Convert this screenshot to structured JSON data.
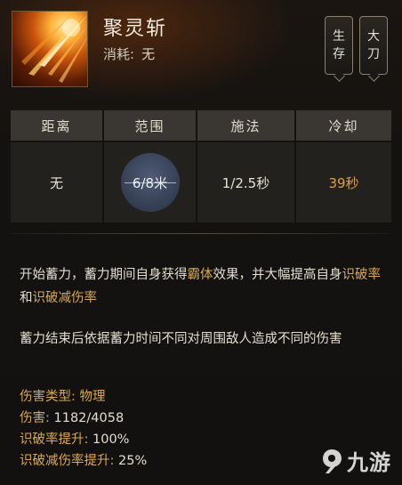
{
  "skill": {
    "name": "聚灵斩",
    "cost_label": "消耗:",
    "cost_value": "无",
    "icon": "flame-slash-icon"
  },
  "tags": [
    {
      "line1": "生",
      "line2": "存"
    },
    {
      "line1": "大",
      "line2": "刀"
    }
  ],
  "stats": {
    "headers": [
      "距离",
      "范围",
      "施法",
      "冷却"
    ],
    "values": [
      "无",
      "6/8米",
      "1/2.5秒",
      "39秒"
    ],
    "cooldown_color": "#d7a24a"
  },
  "description": {
    "p1_a": "开始蓄力，蓄力期间自身获得",
    "p1_hl": "霸体",
    "p1_b": "效果，并大幅提高自身",
    "p1_hl2": "识破率",
    "p1_c": "和",
    "p1_hl3": "识破减伤率",
    "p2": "蓄力结束后依据蓄力时间不同对周围敌人造成不同的伤害"
  },
  "properties": [
    {
      "label": "伤害类型:",
      "value": "物理"
    },
    {
      "label": "伤害:",
      "value": "1182/4058"
    },
    {
      "label": "识破率提升:",
      "value": "100%"
    },
    {
      "label": "识破减伤率提升:",
      "value": "25%"
    }
  ],
  "watermark": {
    "text": "九游",
    "icon": "jiuyou-logo-icon"
  },
  "colors": {
    "gold": "#d9a94f",
    "text": "#e3ddd0",
    "header_bg": "#3a3733",
    "cell_bg": "#23211e"
  }
}
